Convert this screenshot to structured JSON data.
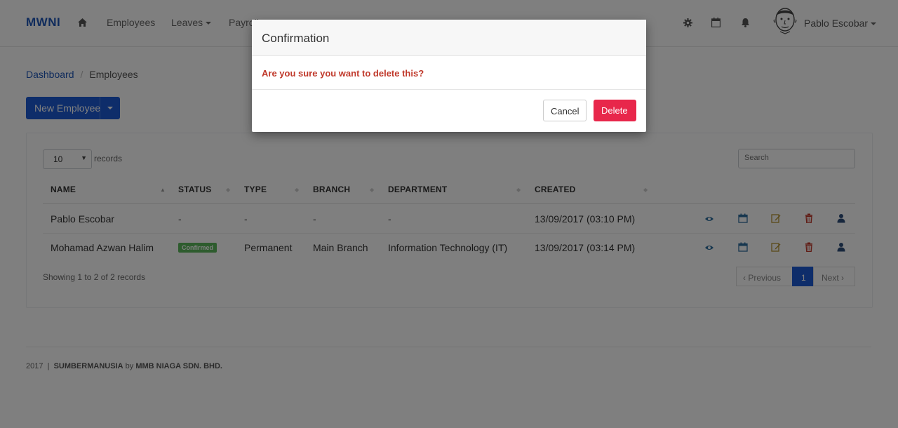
{
  "navbar": {
    "brand": "MWNI",
    "items": [
      {
        "label": "Employees"
      },
      {
        "label": "Leaves"
      },
      {
        "label": "Payroll"
      }
    ],
    "user_name": "Pablo Escobar",
    "icons": [
      "home-icon",
      "gear-icon",
      "calendar-icon",
      "bell-icon",
      "avatar"
    ]
  },
  "breadcrumb": {
    "items": [
      "Dashboard",
      "Employees"
    ]
  },
  "toolbar": {
    "new_label": "New Employee"
  },
  "table": {
    "page_size": "10",
    "records_label": "records",
    "search_placeholder": "Search",
    "columns": [
      "NAME",
      "STATUS",
      "TYPE",
      "BRANCH",
      "DEPARTMENT",
      "CREATED"
    ],
    "rows": [
      {
        "name": "Pablo Escobar",
        "status": "-",
        "type": "-",
        "branch": "-",
        "department": "-",
        "created": "13/09/2017 (03:10 PM)"
      },
      {
        "name": "Mohamad Azwan Halim",
        "status": "Confirmed",
        "type": "Permanent",
        "branch": "Main Branch",
        "department": "Information Technology (IT)",
        "created": "13/09/2017 (03:14 PM)"
      }
    ],
    "row_actions": [
      "view-icon",
      "calendar-icon",
      "edit-icon",
      "delete-icon",
      "user-icon"
    ],
    "summary": "Showing 1 to 2 of 2 records",
    "pagination": {
      "previous": "‹ Previous",
      "current": "1",
      "next": "Next ›"
    }
  },
  "footer": {
    "year": "2017",
    "product": "SUMBERMANUSIA",
    "by": "by",
    "company": "MMB NIAGA SDN. BHD."
  },
  "modal": {
    "title": "Confirmation",
    "message": "Are you sure you want to delete this?",
    "cancel_label": "Cancel",
    "delete_label": "Delete"
  },
  "colors": {
    "brand": "#1f57b8",
    "primary": "#1c5bd4",
    "danger": "#e8274b",
    "success": "#5cb85c",
    "warning_text": "#c0392b"
  }
}
